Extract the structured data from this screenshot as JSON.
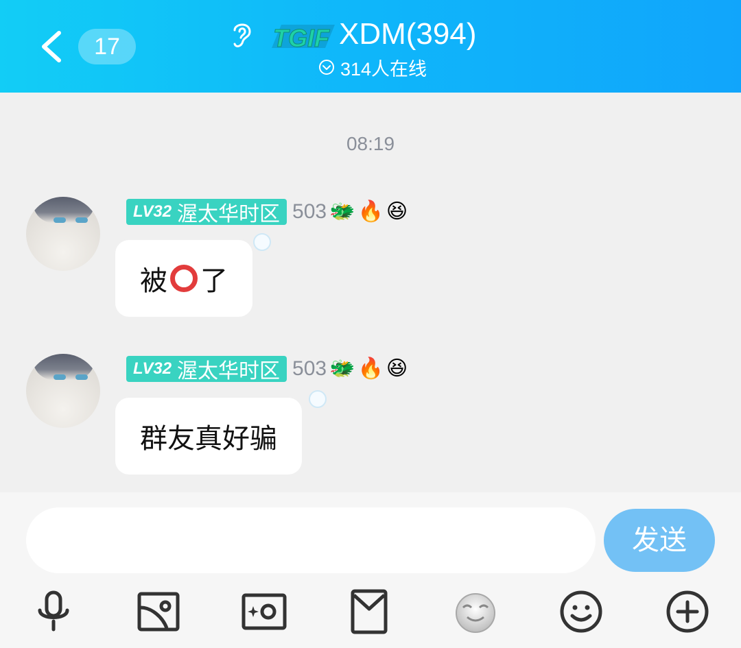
{
  "header": {
    "unread_count": "17",
    "logo_text": "TGIF",
    "title": "XDM(394)",
    "online_status": "314人在线"
  },
  "timestamp": "08:19",
  "messages": [
    {
      "level": "LV32",
      "group_nickname": "渥太华时区",
      "points": "503",
      "badges": [
        "🐲",
        "🔥",
        "😆"
      ],
      "text_before": "被",
      "text_after": "了",
      "inline_emoji": "red-circle"
    },
    {
      "level": "LV32",
      "group_nickname": "渥太华时区",
      "points": "503",
      "badges": [
        "🐲",
        "🔥",
        "😆"
      ],
      "text": "群友真好骗"
    }
  ],
  "composer": {
    "input_value": "",
    "send_label": "发送"
  },
  "toolbar_icons": [
    "microphone-icon",
    "image-icon",
    "camera-icon",
    "red-packet-icon",
    "sticker-face-icon",
    "emoji-icon",
    "plus-icon"
  ],
  "colors": {
    "header_start": "#12cdf6",
    "header_end": "#11a5fb",
    "level_tag": "#39d3c1",
    "send_button": "#73c1f5"
  }
}
